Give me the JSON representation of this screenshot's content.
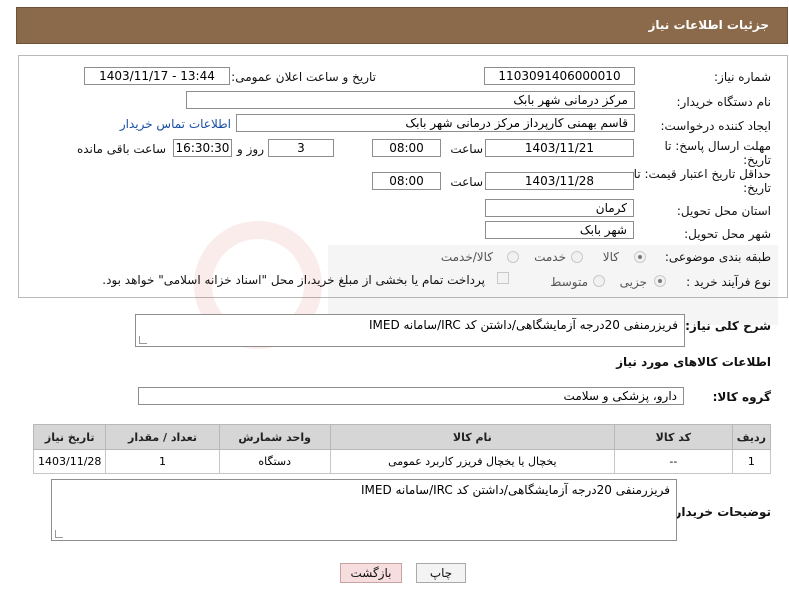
{
  "header": {
    "title": "جزئیات اطلاعات نیاز"
  },
  "fields": {
    "need_number_label": "شماره نیاز:",
    "need_number": "1103091406000010",
    "announce_label": "تاریخ و ساعت اعلان عمومی:",
    "announce_value": "1403/11/17 - 13:44",
    "buyer_label": "نام دستگاه خریدار:",
    "buyer_value": "مرکز درمانی شهر بابک",
    "creator_label": "ایجاد کننده درخواست:",
    "creator_value": "قاسم بهمنی کارپرداز مرکز درمانی شهر بابک",
    "contact_link": "اطلاعات تماس خریدار",
    "deadline_label_1": "مهلت ارسال پاسخ: تا",
    "deadline_label_2": "تاریخ:",
    "deadline_date": "1403/11/21",
    "time_label": "ساعت",
    "deadline_time": "08:00",
    "days_value": "3",
    "days_label": "روز و",
    "remaining_time": "16:30:30",
    "remaining_label": "ساعت باقی مانده",
    "validity_label_1": "حداقل تاریخ اعتبار قیمت: تا",
    "validity_label_2": "تاریخ:",
    "validity_date": "1403/11/28",
    "validity_time": "08:00",
    "province_label": "استان محل تحویل:",
    "province_value": "کرمان",
    "city_label": "شهر محل تحویل:",
    "city_value": "شهر بابک",
    "category_label": "طبقه بندی موضوعی:",
    "category_options": [
      "کالا",
      "خدمت",
      "کالا/خدمت"
    ],
    "category_selected": "کالا",
    "process_label": "نوع فرآیند خرید :",
    "process_options": [
      "جزیی",
      "متوسط"
    ],
    "process_selected": "جزیی",
    "payment_note": "پرداخت تمام یا بخشی از مبلغ خرید،از محل \"اسناد خزانه اسلامی\" خواهد بود."
  },
  "summary": {
    "label": "شرح کلی نیاز:",
    "value": "فریزرمنفی 20درجه آزمایشگاهی/داشتن کد IRC/سامانه IMED"
  },
  "goods": {
    "section_title": "اطلاعات کالاهای مورد نیاز",
    "group_label": "گروه کالا:",
    "group_value": "دارو، پزشکی و سلامت",
    "columns": [
      "ردیف",
      "کد کالا",
      "نام کالا",
      "واحد شمارش",
      "تعداد / مقدار",
      "تاریخ نیاز"
    ],
    "rows": [
      [
        "1",
        "--",
        "یخچال یا یخچال فریزر کاربرد عمومی",
        "دستگاه",
        "1",
        "1403/11/28"
      ]
    ]
  },
  "buyer_notes": {
    "label": "توضیحات خریدار:",
    "value": "فریزرمنفی 20درجه آزمایشگاهی/داشتن کد IRC/سامانه IMED"
  },
  "buttons": {
    "print": "چاپ",
    "back": "بازگشت"
  },
  "colors": {
    "header_bg": "#8a6a4a",
    "link": "#1a4fa3",
    "back_btn_bg": "#f7dede"
  }
}
